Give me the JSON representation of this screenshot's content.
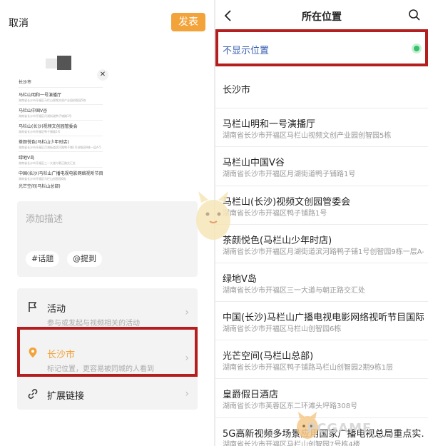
{
  "left": {
    "cancel_label": "取消",
    "publish_label": "发表",
    "preview": {
      "items": [
        {
          "title": "长沙市",
          "sub": ""
        },
        {
          "title": "马栏山明和一号演播厅",
          "sub": "湖南省长沙市开福区马栏山视频文创产业园创智园5栋"
        },
        {
          "title": "马栏山中国V谷",
          "sub": "湖南省长沙市开福区月湖街道鸭子铺路1号"
        },
        {
          "title": "马栏山(长沙)视频文创园管委会",
          "sub": "湖南省长沙市开福区鸭子铺路1号"
        },
        {
          "title": "茶颜悦色(马栏山少年时店)",
          "sub": "湖南省长沙市开福区月湖街道滨河路鸭子铺1号创智园9栋一层A-5"
        },
        {
          "title": "绿地V岛",
          "sub": "湖南省长沙市开福区三一大道与朝正路交汇处"
        },
        {
          "title": "中国(长沙)马栏山广播电视电影网络视听节目国际…",
          "sub": "湖南省长沙市开福区马栏山创智园6栋"
        },
        {
          "title": "光芒空间(马栏山总部)",
          "sub": ""
        }
      ]
    },
    "description_placeholder": "添加描述",
    "chip_topic": "#话题",
    "chip_mention": "@提到",
    "options": {
      "activity_title": "活动",
      "activity_sub": "参与或发起与视频相关的活动",
      "location_title": "长沙市",
      "location_sub": "标记位置，更容易被同城的人看到",
      "extend_title": "扩展链接"
    },
    "accent_color": "#f2a33a"
  },
  "right": {
    "title": "所在位置",
    "no_display_label": "不显示位置",
    "locations": [
      {
        "name": "长沙市",
        "address": ""
      },
      {
        "name": "马栏山明和一号演播厅",
        "address": "湖南省长沙市开福区马栏山视频文创产业园创智园5栋"
      },
      {
        "name": "马栏山中国V谷",
        "address": "湖南省长沙市开福区月湖街道鸭子铺路1号"
      },
      {
        "name": "马栏山(长沙)视频文创园管委会",
        "address": "湖南省长沙市开福区鸭子铺路1号"
      },
      {
        "name": "茶颜悦色(马栏山少年时店)",
        "address": "湖南省长沙市开福区月湖街道滨河路鸭子铺1号创智园9栋一层A-5…"
      },
      {
        "name": "绿地V岛",
        "address": "湖南省长沙市开福区三一大道与朝正路交汇处"
      },
      {
        "name": "中国(长沙)马栏山广播电视电影网络视听节目国际…",
        "address": "湖南省长沙市开福区马栏山创智园6栋"
      },
      {
        "name": "光芒空间(马栏山总部)",
        "address": "湖南省长沙市开福区鸭子铺路马栏山创智园2期9栋1层"
      },
      {
        "name": "皇爵假日酒店",
        "address": "湖南省长沙市芙蓉区东二环滩头坪路308号"
      },
      {
        "name": "5G高新视频多场景应用国家广播电视总局重点实…",
        "address": "湖南省长沙市开福区马栏山创智园7号栋4楼"
      }
    ],
    "selected_color": "#36c26a",
    "highlight_color": "#b51e1e"
  },
  "watermark": "PCGAME"
}
